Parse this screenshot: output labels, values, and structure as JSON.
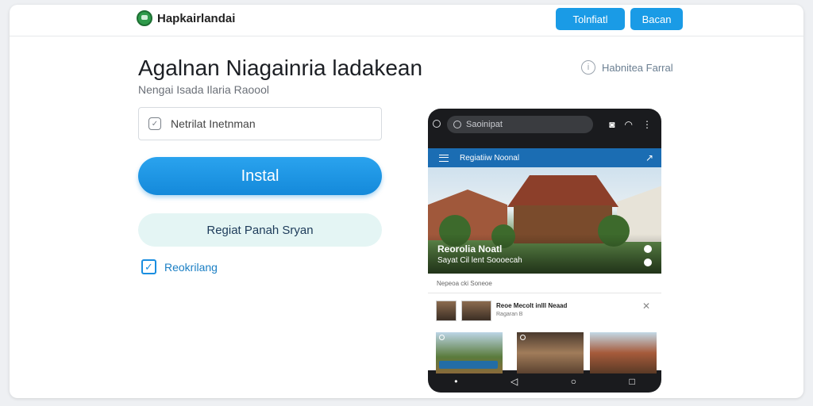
{
  "header": {
    "brand": "Hapkairlandai",
    "btn_primary": "Tolnfiatl",
    "btn_secondary": "Bacan",
    "logo_icon": "leaf-badge-icon"
  },
  "hero": {
    "title": "Agalnan Niagainria ladakean",
    "subtitle": "Nengai Isada Ilaria Raoool"
  },
  "help": {
    "label": "Habnitea Farral",
    "icon": "info-circle-icon"
  },
  "form": {
    "field_placeholder": "Netrilat Inetnman",
    "install_label": "Instal",
    "secondary_label": "Regiat Panah Sryan",
    "checkbox_label": "Reokrilang",
    "checkbox_checked": true
  },
  "phone": {
    "search_text": "Saoinipat",
    "appbar_title": "Regiatiiw Noonal",
    "hero_title": "Reorolia Noatl",
    "hero_sub": "Sayat Cil lent Soooecah",
    "section_label": "Nepeoa cki Soneoe",
    "row_title": "Reoe Mecolt inlll Neaad",
    "row_meta": "Ragaran B",
    "colors": {
      "appbar": "#1b6db3",
      "accent": "#1a9be6"
    }
  }
}
